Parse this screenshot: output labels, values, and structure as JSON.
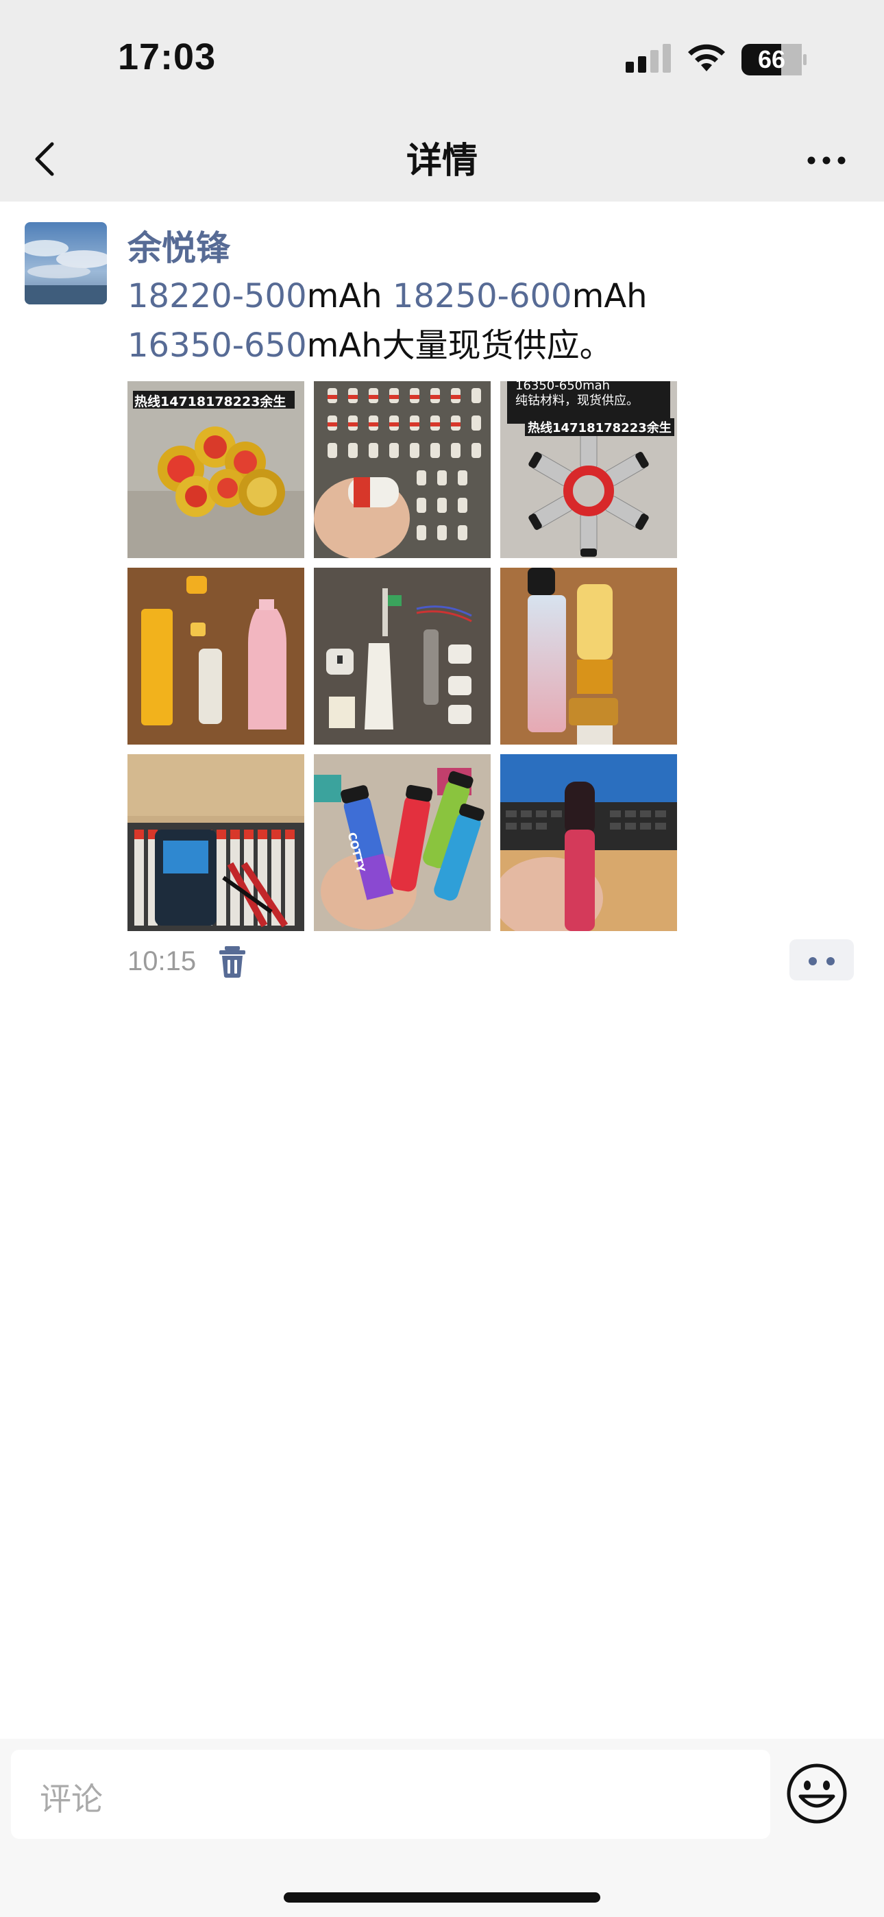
{
  "status_bar": {
    "time": "17:03",
    "battery": "66",
    "icons": [
      "cellular-signal-icon",
      "wifi-icon",
      "battery-icon"
    ]
  },
  "nav": {
    "title": "详情",
    "back_icon": "chevron-left-icon",
    "more_icon": "more-dots-icon"
  },
  "post": {
    "author": "余悦锋",
    "text_segments": [
      {
        "text": "18220-500",
        "link": true
      },
      {
        "text": "mAh ",
        "link": false
      },
      {
        "text": "18250-600",
        "link": true
      },
      {
        "text": "mAh",
        "link": false
      },
      {
        "text": "16350-650",
        "link": true
      },
      {
        "text": "mAh大量现货供应。",
        "link": false
      }
    ],
    "images": [
      {
        "caption": "热线14718178223余生"
      },
      {
        "caption": ""
      },
      {
        "caption_top": "16350-650mah",
        "caption_line2": "纯钴材料，现货供应。",
        "caption": "热线14718178223余生"
      },
      {
        "caption": ""
      },
      {
        "caption": ""
      },
      {
        "caption": ""
      },
      {
        "caption": ""
      },
      {
        "caption": "COTTY"
      },
      {
        "caption": ""
      }
    ],
    "time": "10:15"
  },
  "comment_bar": {
    "placeholder": "评论"
  },
  "colors": {
    "link": "#576b95",
    "nav_bg": "#ededed",
    "time_gray": "#9b9b9b"
  }
}
